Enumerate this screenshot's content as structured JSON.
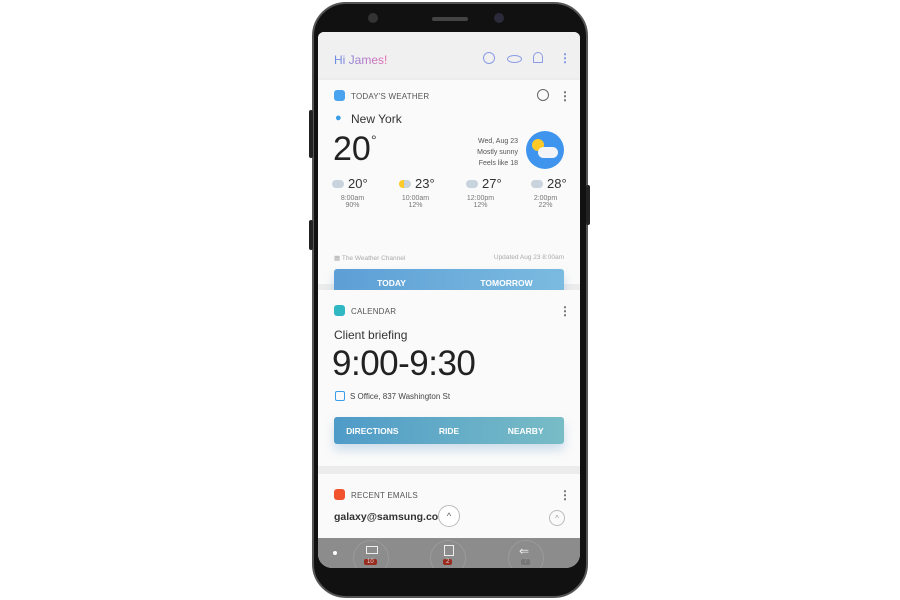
{
  "header": {
    "greeting": "Hi James!",
    "icons": [
      "bixby-icon",
      "vision-icon",
      "bell-icon",
      "more-icon"
    ]
  },
  "weather": {
    "title": "TODAY'S WEATHER",
    "city": "New York",
    "temp": "20",
    "deg": "°",
    "date": "Wed, Aug 23",
    "condition": "Mostly sunny",
    "feels": "Feels like 18",
    "hourly": [
      {
        "temp": "20°",
        "time": "8:00am",
        "pct": "90%",
        "icon": "rain-cloud-icon"
      },
      {
        "temp": "23°",
        "time": "10:00am",
        "pct": "12%",
        "icon": "partly-sunny-icon"
      },
      {
        "temp": "27°",
        "time": "12:00pm",
        "pct": "12%",
        "icon": "cloud-icon"
      },
      {
        "temp": "28°",
        "time": "2:00pm",
        "pct": "22%",
        "icon": "cloud-icon"
      }
    ],
    "source": "The Weather Channel",
    "updated": "Updated Aug 23  8:00am",
    "tabs": [
      "TODAY",
      "TOMORROW"
    ]
  },
  "calendar": {
    "title": "CALENDAR",
    "event": "Client briefing",
    "time": "9:00-9:30",
    "location": "S Office, 837 Washington St",
    "actions": [
      "DIRECTIONS",
      "RIDE",
      "NEARBY"
    ]
  },
  "emails": {
    "title": "RECENT EMAILS",
    "address": "galaxy@samsung.com"
  },
  "dock": {
    "badges": [
      "10",
      "2",
      "7"
    ]
  },
  "colors": {
    "accent": "#4a90d9",
    "email": "#f0532d",
    "calendar": "#2fb7c4"
  }
}
